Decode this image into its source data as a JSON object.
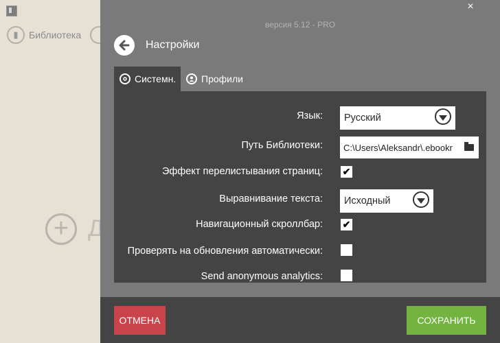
{
  "background_app": {
    "library_label": "Библиотека",
    "big_letter": "Д"
  },
  "dialog": {
    "version": "версия 5.12 - PRO",
    "close_glyph": "×",
    "title": "Настройки",
    "tabs": [
      {
        "label": "Системн.",
        "icon": "gears-icon",
        "active": true
      },
      {
        "label": "Профили",
        "icon": "profile-icon",
        "active": false
      }
    ],
    "settings": {
      "language_label": "Язык:",
      "language_value": "Русский",
      "library_path_label": "Путь Библиотеки:",
      "library_path_value": "C:\\Users\\Aleksandr\\.ebookr",
      "page_flip_label": "Эффект перелистывания страниц:",
      "page_flip_checked": true,
      "text_align_label": "Выравнивание текста:",
      "text_align_value": "Исходный",
      "nav_scrollbar_label": "Навигационный скроллбар:",
      "nav_scrollbar_checked": true,
      "auto_update_label": "Проверять на обновления автоматически:",
      "auto_update_checked": false,
      "analytics_label": "Send anonymous analytics:",
      "analytics_checked": false
    },
    "check_glyph": "✔",
    "cancel_label": "ОТМЕНА",
    "save_label": "СОХРАНИТЬ",
    "colors": {
      "cancel": "#c8444a",
      "save": "#73b440",
      "panel": "#444444",
      "overlay": "#7a7a7a"
    }
  }
}
